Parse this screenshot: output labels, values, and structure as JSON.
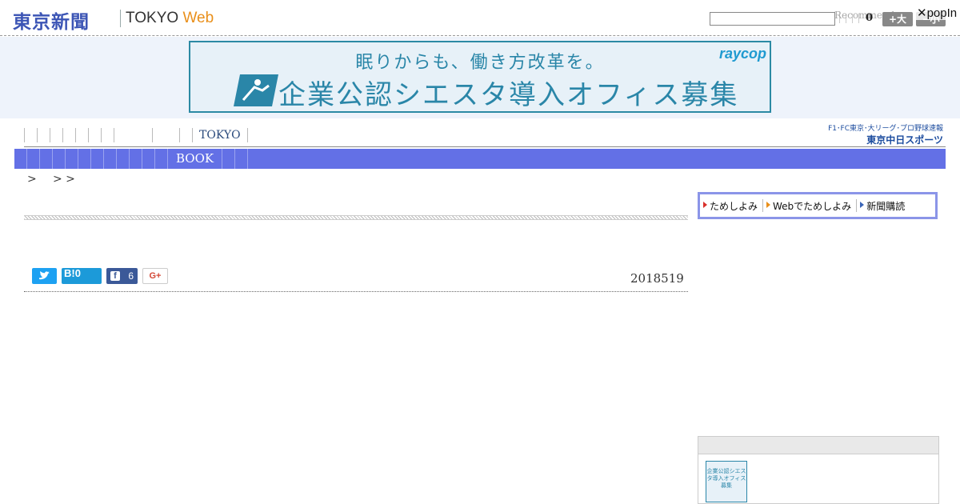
{
  "header": {
    "logo_jp": "東京新聞",
    "logo_en": "TOKYO",
    "logo_web": "Web",
    "search_placeholder": "",
    "recommend_label": "Recommend",
    "recommend_count": "0",
    "font_large_label": "+大",
    "font_small_label": "−小",
    "popin_label": "✕popIn"
  },
  "ad": {
    "line1": "眠りからも、働き方改革を。",
    "line2": "企業公認シエスタ導入オフィス募集",
    "brand": "raycop"
  },
  "category_nav": {
    "label": "TOKYO"
  },
  "chunichi": {
    "line1": "F1･FC東京･大リーグ･プロ野球速報",
    "line2": "東京中日スポーツ"
  },
  "menu": {
    "book_label": "BOOK"
  },
  "breadcrumb": {
    "sep1": ">",
    "sep2": "> >"
  },
  "share": {
    "hatena_label": "B!0",
    "facebook_count": "6",
    "gplus_label": "G+"
  },
  "article": {
    "date": "2018519"
  },
  "sub_nav": {
    "item1": "ためしよみ",
    "item2": "Webでためしよみ",
    "item3": "新聞購読"
  },
  "side_ad": {
    "thumb_text": "企業公認シエスタ導入オフィス募集"
  },
  "colors": {
    "menu_bar": "#6370e6",
    "logo_blue": "#3c55b5",
    "web_orange": "#e98f1a",
    "ad_teal": "#2a86a8"
  }
}
